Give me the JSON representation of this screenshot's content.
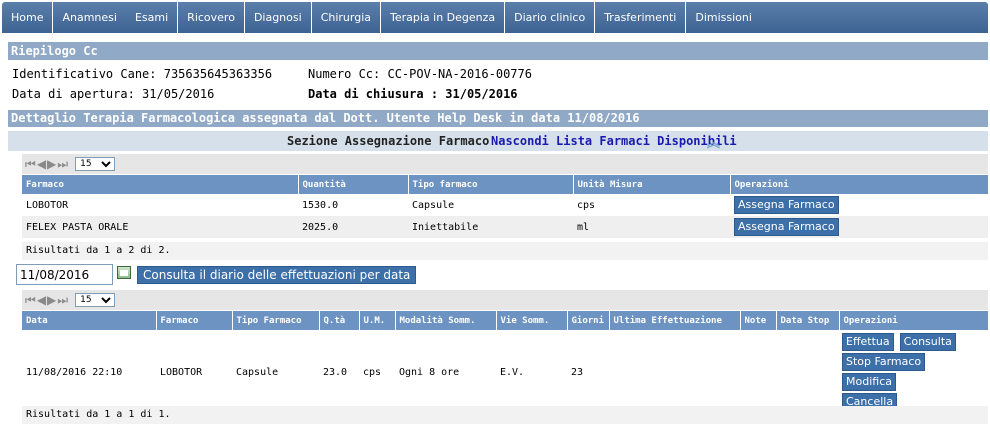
{
  "nav": {
    "items": [
      "Home",
      "Anamnesi",
      "Esami",
      "Ricovero",
      "Diagnosi",
      "Chirurgia",
      "Terapia in Degenza",
      "Diario clinico",
      "Trasferimenti",
      "Dimissioni"
    ]
  },
  "riepilogo": {
    "title": "Riepilogo Cc",
    "identificativo": "Identificativo Cane: 735635645363356",
    "numero_cc": "Numero Cc: CC-POV-NA-2016-00776",
    "data_apertura": "Data di apertura: 31/05/2016",
    "data_chiusura": "Data di chiusura : 31/05/2016"
  },
  "dettaglio": {
    "title": "Dettaglio Terapia Farmacologica assegnata dal Dott. Utente Help Desk in data 11/08/2016"
  },
  "assegnazione": {
    "title": "Sezione Assegnazione Farmaco",
    "hide_link": "Nascondi Lista Farmaci Disponibili",
    "chev": "≈"
  },
  "pager": {
    "page_size": "15",
    "arrows": [
      "|◀",
      "◀",
      "▶",
      "▶|"
    ]
  },
  "farmaci_table": {
    "headers": [
      "Farmaco",
      "Quantità",
      "Tipo farmaco",
      "Unità Misura",
      "Operazioni"
    ],
    "rows": [
      {
        "farmaco": "LOBOTOR",
        "quantita": "1530.0",
        "tipo": "Capsule",
        "unita": "cps",
        "op": "Assegna Farmaco"
      },
      {
        "farmaco": "FELEX PASTA ORALE",
        "quantita": "2025.0",
        "tipo": "Iniettabile",
        "unita": "ml",
        "op": "Assegna Farmaco"
      }
    ],
    "result": "Risultati da 1 a 2 di 2."
  },
  "date_filter": {
    "value": "11/08/2016",
    "button": "Consulta il diario delle effettuazioni per data"
  },
  "terapia_table": {
    "headers": [
      "Data",
      "Farmaco",
      "Tipo Farmaco",
      "Q.tà",
      "U.M.",
      "Modalità Somm.",
      "Vie Somm.",
      "Giorni",
      "Ultima Effettuazione",
      "Note",
      "Data Stop",
      "Operazioni"
    ],
    "rows": [
      {
        "data": "11/08/2016 22:10",
        "farmaco": "LOBOTOR",
        "tipo": "Capsule",
        "qta": "23.0",
        "um": "cps",
        "modalita": "Ogni 8 ore",
        "vie": "E.V.",
        "giorni": "23",
        "ultima": "",
        "note": "",
        "data_stop": "",
        "ops": [
          "Effettua",
          "Consulta",
          "Stop Farmaco",
          "Modifica",
          "Cancella"
        ]
      }
    ],
    "result": "Risultati da 1 a 1 di 1."
  }
}
